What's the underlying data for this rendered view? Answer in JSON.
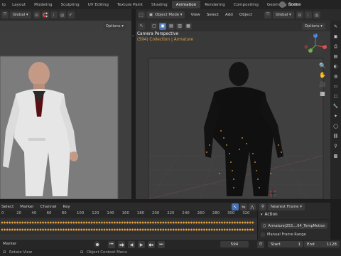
{
  "app": {
    "logo_label": "lp",
    "workspace_tabs": [
      "Layout",
      "Modeling",
      "Sculpting",
      "UV Editing",
      "Texture Paint",
      "Shading",
      "Animation",
      "Rendering",
      "Compositing",
      "Geometry Node"
    ],
    "active_tab": "Animation",
    "scene_name": "Scene"
  },
  "left_header": {
    "orientation": "Global",
    "options": "Options"
  },
  "right_header": {
    "mode": "Object Mode",
    "menus": [
      "View",
      "Select",
      "Add",
      "Object"
    ],
    "orientation": "Global",
    "options": "Options"
  },
  "viewport": {
    "camera_title": "Camera Perspective",
    "collection_line": "(594) Collection | Armature"
  },
  "gizmo": {
    "x_label": "X",
    "y_label": "Y",
    "z_label": "Z"
  },
  "timeline": {
    "menus": [
      "Select",
      "Marker",
      "Channel",
      "Key"
    ],
    "snap_mode": "Nearest Frame",
    "ticks": [
      "0",
      "20",
      "40",
      "60",
      "80",
      "100",
      "120",
      "140",
      "160",
      "180",
      "200",
      "220",
      "240",
      "260",
      "280",
      "300",
      "320"
    ]
  },
  "action_panel": {
    "header": "Action",
    "action_name": "Armature|253....64_TempMotion",
    "manual_range": "Manual Frame Range"
  },
  "playback": {
    "marker_label": "Marker",
    "current_frame": "594",
    "start_label": "Start",
    "start_value": "1",
    "end_label": "End",
    "end_value": "1128"
  },
  "status": {
    "left": "Rotate View",
    "middle": "Object Context Menu"
  },
  "colors": {
    "accent": "#4772b3",
    "active_tab_bg": "#3d3d3d",
    "keyframe": "#e8a33a",
    "orange_text": "#e0a040",
    "axis_x": "#e05050",
    "axis_y": "#6fb04f",
    "axis_z": "#4d8de0"
  }
}
